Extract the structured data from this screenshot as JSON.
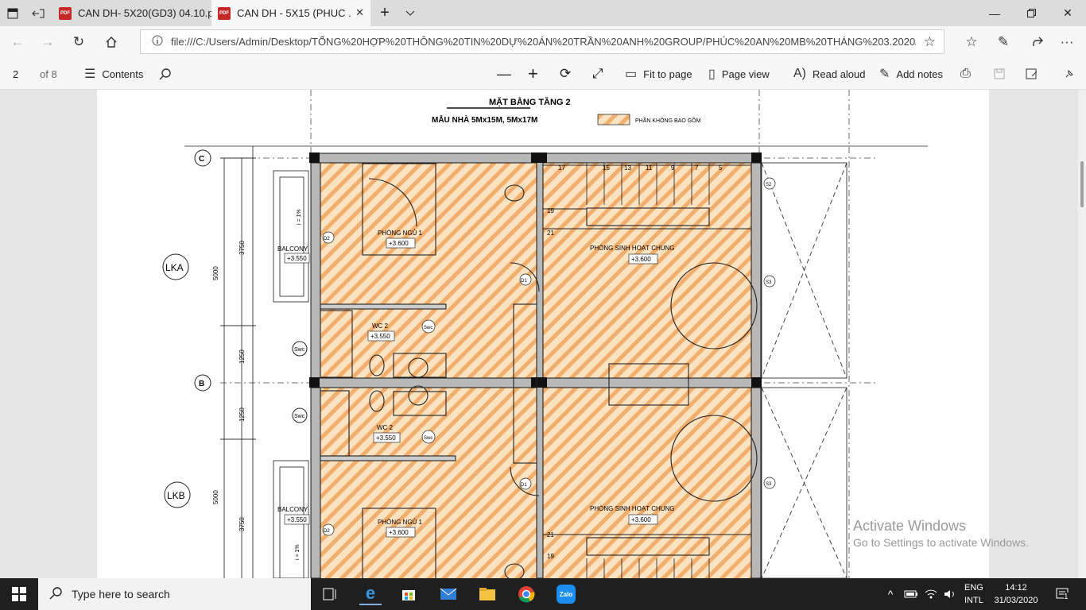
{
  "tabs": [
    {
      "title": "CAN DH- 5X20(GD3) 04.10.p"
    },
    {
      "title": "CAN DH - 5X15 (PHUC ."
    }
  ],
  "address": {
    "url": "file:///C:/Users/Admin/Desktop/TỔNG%20HỢP%20THÔNG%20TIN%20DỰ%20ÁN%20TRẦN%20ANH%20GROUP/PHÚC%20AN%20MB%20THÁNG%203.2020/CAN%"
  },
  "pdf_toolbar": {
    "page": "2",
    "of_pages": "of 8",
    "contents": "Contents",
    "fit_to_page": "Fit to page",
    "page_view": "Page view",
    "read_aloud": "Read aloud",
    "add_notes": "Add notes"
  },
  "drawing": {
    "title": "MẶT BẰNG TẦNG 2",
    "subtitle": "MẪU NHÀ  5Mx15M, 5Mx17M",
    "legend": "PHẦN KHÔNG BAO GỒM",
    "grid_c": "C",
    "grid_b": "B",
    "lka": "LKA",
    "lkb": "LKB",
    "dim_3750": "3750",
    "dim_5000": "5000",
    "dim_1250": "1250",
    "slope": "i = 1%",
    "balcony": "BALCONY",
    "elev_3550": "+3.550",
    "elev_3600": "+3.600",
    "bedroom1": "PHÒNG NGỦ 1",
    "living": "PHÒNG SINH HOẠT CHUNG",
    "wc2": "WC 2",
    "swc": "Swc",
    "d1": "D1",
    "d2": "D2",
    "s2": "S2",
    "s3": "S3",
    "stair": [
      "17",
      "15",
      "13",
      "11",
      "9",
      "7",
      "5"
    ],
    "step19": "19",
    "step21": "21"
  },
  "watermark": {
    "line1": "Activate Windows",
    "line2": "Go to Settings to activate Windows."
  },
  "taskbar": {
    "search_placeholder": "Type here to search",
    "lang1": "ENG",
    "lang2": "INTL",
    "time": "14:12",
    "date": "31/03/2020",
    "notif": "1",
    "zalo": "Zalo"
  }
}
